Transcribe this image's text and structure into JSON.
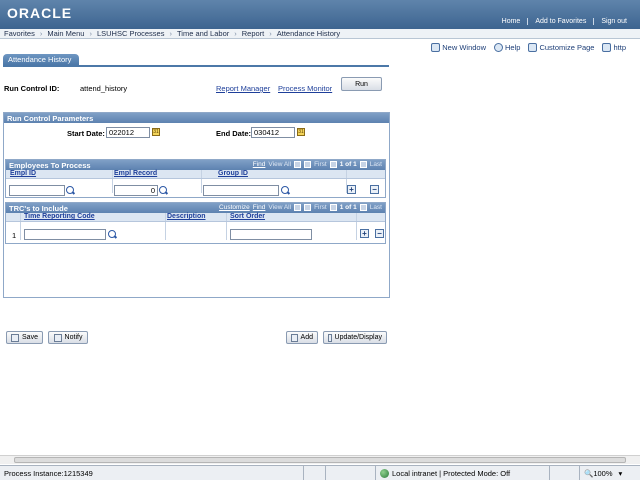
{
  "header": {
    "logo": "ORACLE",
    "links": [
      "Home",
      "Add to Favorites",
      "Sign out"
    ]
  },
  "nav": {
    "items": [
      "Favorites",
      "Main Menu",
      "LSUHSC Processes",
      "Time and Labor",
      "Report",
      "Attendance History"
    ],
    "sep": "›"
  },
  "toollinks": [
    "New Window",
    "Help",
    "Customize Page",
    "http"
  ],
  "tab": {
    "label": "Attendance History"
  },
  "run_control": {
    "label": "Run Control ID:",
    "value": "attend_history",
    "report_manager": "Report Manager",
    "process_monitor": "Process Monitor",
    "run_button": "Run"
  },
  "params": {
    "title": "Run Control Parameters",
    "start_label": "Start Date:",
    "start_value": "022012",
    "end_label": "End Date:",
    "end_value": "030412"
  },
  "employees": {
    "title": "Employees To Process",
    "nav": {
      "find": "Find",
      "view_all": "View All",
      "first": "First",
      "count": "1 of 1",
      "last": "Last"
    },
    "columns": [
      "Empl ID",
      "Empl Record",
      "Group ID"
    ],
    "row": {
      "empl_id": "",
      "empl_record": "0",
      "group_id": ""
    }
  },
  "trc": {
    "title": "TRC's to Include",
    "nav": {
      "customize": "Customize",
      "find": "Find",
      "view_all": "View All",
      "first": "First",
      "count": "1 of 1",
      "last": "Last"
    },
    "columns": [
      "Time Reporting Code",
      "Description",
      "Sort Order"
    ],
    "row": {
      "num": "1",
      "trc": "",
      "description": "",
      "sort_order": ""
    }
  },
  "buttons": {
    "save": "Save",
    "notify": "Notify",
    "add": "Add",
    "update": "Update/Display"
  },
  "plus": "+",
  "minus": "−",
  "calendar_glyph": "31",
  "status": {
    "process": "Process Instance:1215349",
    "zone": "Local intranet | Protected Mode: Off",
    "zoom": "100%"
  }
}
